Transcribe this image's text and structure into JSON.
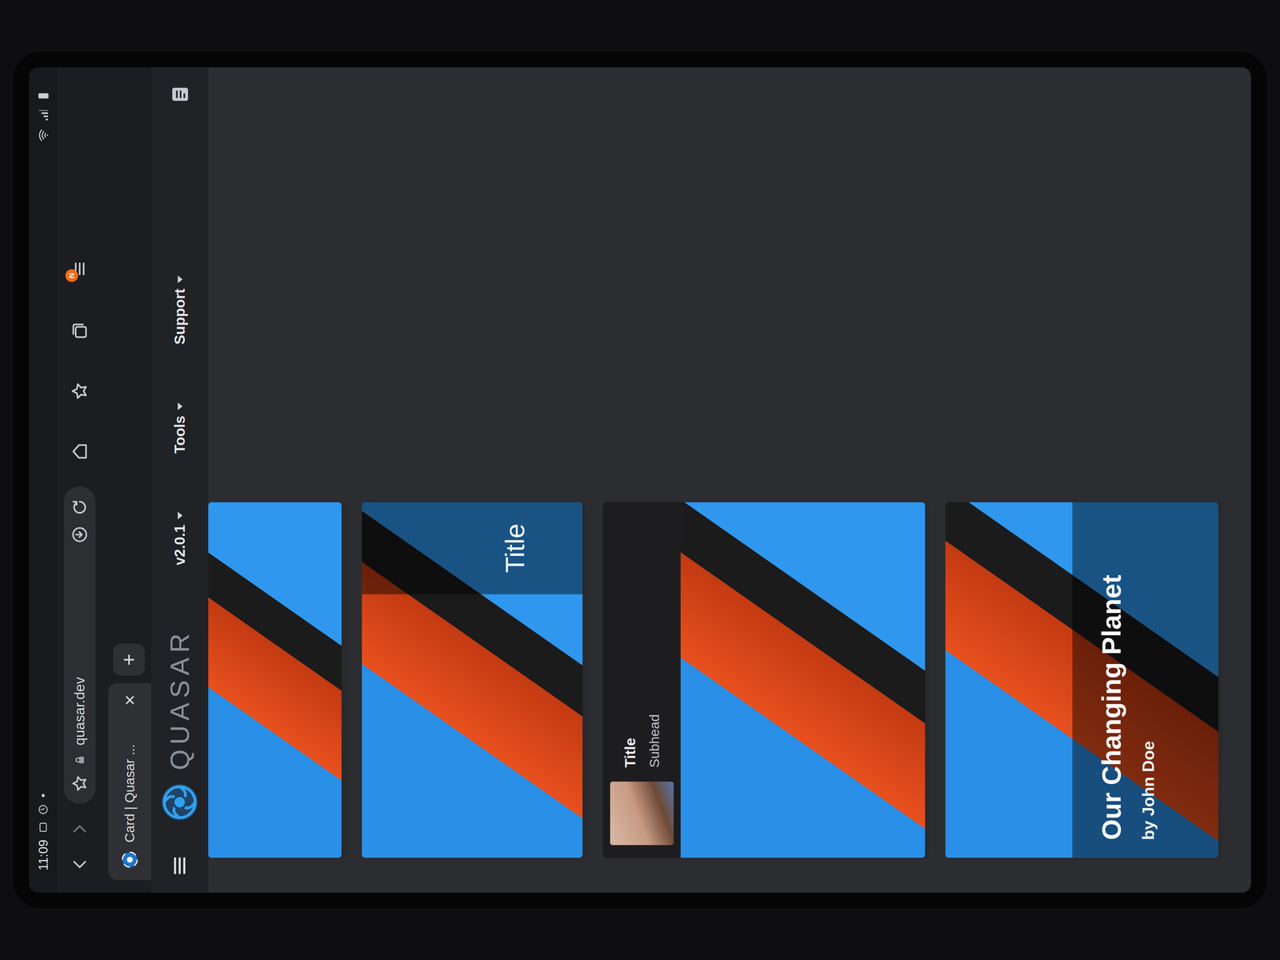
{
  "status_bar": {
    "time": "11:09"
  },
  "address_bar": {
    "url": "quasar.dev",
    "menu_badge": "N"
  },
  "tabs": [
    {
      "label": "Card | Quasar ...",
      "selected": true,
      "close": "×"
    }
  ],
  "new_tab": "+",
  "header": {
    "logo": "QUASAR",
    "version": "v2.0.1",
    "nav": [
      {
        "label": "Tools"
      },
      {
        "label": "Support"
      }
    ]
  },
  "cards": [
    {
      "kind": "image"
    },
    {
      "kind": "side-caption",
      "caption": "Title"
    },
    {
      "kind": "item-header",
      "title": "Title",
      "subtitle": "Subhead"
    },
    {
      "kind": "bottom-caption",
      "title": "Our Changing Planet",
      "subtitle": "by John Doe"
    }
  ]
}
